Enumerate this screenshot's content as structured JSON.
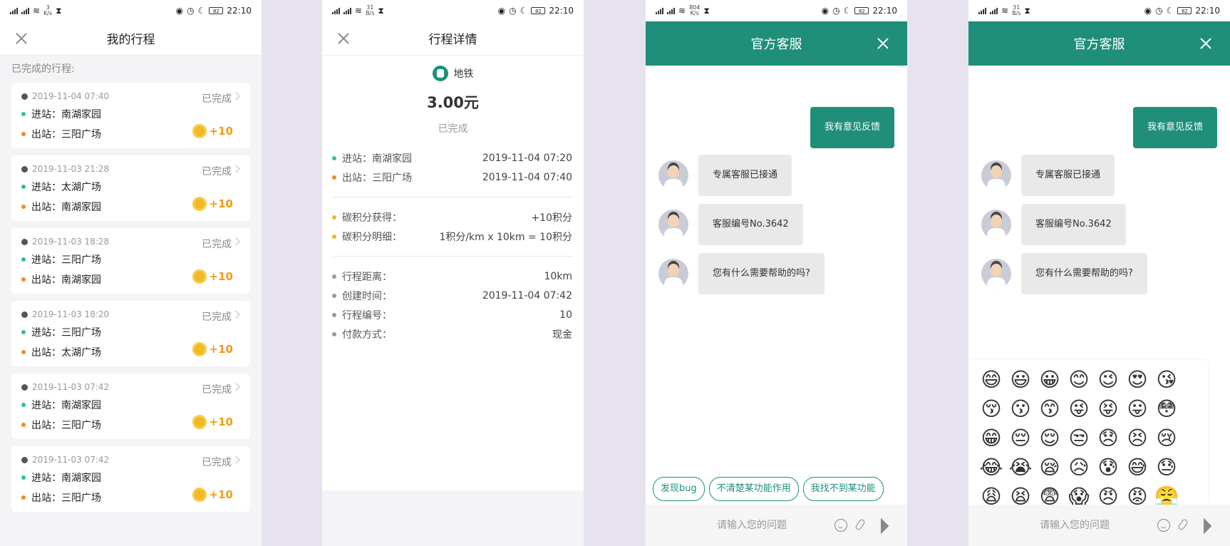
{
  "status_bars": [
    {
      "speed_top": "3",
      "speed_bottom": "K/s",
      "time": "22:10",
      "battery": "82"
    },
    {
      "speed_top": "31",
      "speed_bottom": "B/s",
      "time": "22:10",
      "battery": "82"
    },
    {
      "speed_top": "804",
      "speed_bottom": "K/s",
      "time": "22:10",
      "battery": "82"
    },
    {
      "speed_top": "31",
      "speed_bottom": "B/s",
      "time": "22:10",
      "battery": "82"
    }
  ],
  "panel1": {
    "title": "我的行程",
    "section_label": "已完成的行程:",
    "trips": [
      {
        "time": "2019-11-04 07:40",
        "status": "已完成",
        "in": "进站：南湖家园",
        "out": "出站：三阳广场",
        "points": "+10"
      },
      {
        "time": "2019-11-03 21:28",
        "status": "已完成",
        "in": "进站：太湖广场",
        "out": "出站：南湖家园",
        "points": "+10"
      },
      {
        "time": "2019-11-03 18:28",
        "status": "已完成",
        "in": "进站：三阳广场",
        "out": "出站：南湖家园",
        "points": "+10"
      },
      {
        "time": "2019-11-03 18:20",
        "status": "已完成",
        "in": "进站：三阳广场",
        "out": "出站：太湖广场",
        "points": "+10"
      },
      {
        "time": "2019-11-03 07:42",
        "status": "已完成",
        "in": "进站：南湖家园",
        "out": "出站：三阳广场",
        "points": "+10"
      },
      {
        "time": "2019-11-03 07:42",
        "status": "已完成",
        "in": "进站：南湖家园",
        "out": "出站：三阳广场",
        "points": "+10"
      }
    ]
  },
  "panel2": {
    "title": "行程详情",
    "mode": "地铁",
    "price": "3.00元",
    "status": "已完成",
    "stations": [
      {
        "k": "进站：南湖家园",
        "v": "2019-11-04 07:20"
      },
      {
        "k": "出站：三阳广场",
        "v": "2019-11-04 07:40"
      }
    ],
    "points": [
      {
        "k": "碳积分获得：",
        "v": "+10积分"
      },
      {
        "k": "碳积分明细：",
        "v": "1积分/km x 10km = 10积分"
      }
    ],
    "info": [
      {
        "k": "行程距离：",
        "v": "10km"
      },
      {
        "k": "创建时间：",
        "v": "2019-11-04 07:42"
      },
      {
        "k": "行程编号：",
        "v": "10"
      },
      {
        "k": "付款方式：",
        "v": "现金"
      }
    ]
  },
  "chat": {
    "title": "官方客服",
    "user_msg": "我有意见反馈",
    "agent_msgs": [
      "专属客服已接通",
      "客服编号No.3642",
      "您有什么需要帮助的吗?"
    ],
    "chips": [
      "发现bug",
      "不清楚某功能作用",
      "我找不到某功能"
    ],
    "placeholder": "请输入您的问题"
  },
  "emojis": [
    "😄",
    "😃",
    "😀",
    "😊",
    "😉",
    "😍",
    "😘",
    "😚",
    "😗",
    "😙",
    "😜",
    "😝",
    "😛",
    "😳",
    "😁",
    "😔",
    "😌",
    "😒",
    "😞",
    "😣",
    "😢",
    "😂",
    "😭",
    "😪",
    "😥",
    "😰",
    "😅",
    "😓",
    "😩",
    "😫",
    "😨",
    "😱",
    "😠",
    "😡",
    "😤"
  ],
  "colors": {
    "accent": "#1f8f79",
    "points": "#f39c12",
    "in_dot": "#2ec295",
    "out_dot": "#f08a24"
  }
}
